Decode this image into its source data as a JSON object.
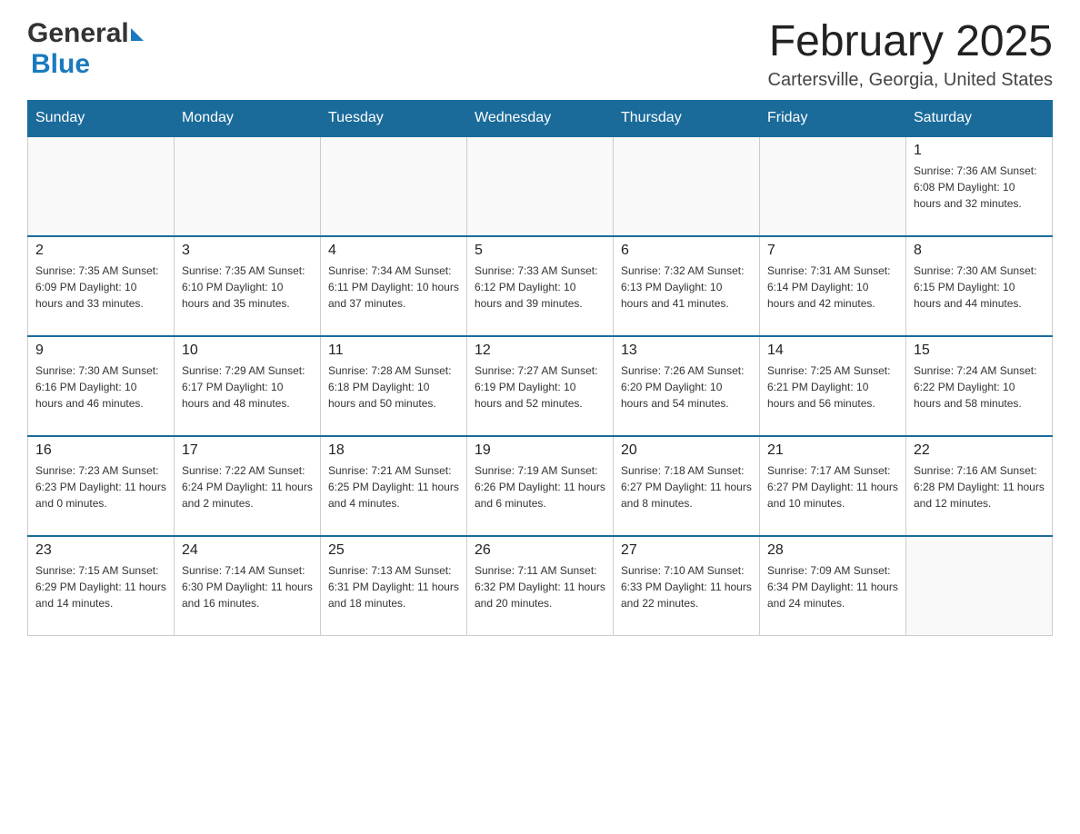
{
  "header": {
    "logo_general": "General",
    "logo_blue": "Blue",
    "month_title": "February 2025",
    "location": "Cartersville, Georgia, United States"
  },
  "calendar": {
    "days_of_week": [
      "Sunday",
      "Monday",
      "Tuesday",
      "Wednesday",
      "Thursday",
      "Friday",
      "Saturday"
    ],
    "weeks": [
      [
        {
          "day": "",
          "info": ""
        },
        {
          "day": "",
          "info": ""
        },
        {
          "day": "",
          "info": ""
        },
        {
          "day": "",
          "info": ""
        },
        {
          "day": "",
          "info": ""
        },
        {
          "day": "",
          "info": ""
        },
        {
          "day": "1",
          "info": "Sunrise: 7:36 AM\nSunset: 6:08 PM\nDaylight: 10 hours and 32 minutes."
        }
      ],
      [
        {
          "day": "2",
          "info": "Sunrise: 7:35 AM\nSunset: 6:09 PM\nDaylight: 10 hours and 33 minutes."
        },
        {
          "day": "3",
          "info": "Sunrise: 7:35 AM\nSunset: 6:10 PM\nDaylight: 10 hours and 35 minutes."
        },
        {
          "day": "4",
          "info": "Sunrise: 7:34 AM\nSunset: 6:11 PM\nDaylight: 10 hours and 37 minutes."
        },
        {
          "day": "5",
          "info": "Sunrise: 7:33 AM\nSunset: 6:12 PM\nDaylight: 10 hours and 39 minutes."
        },
        {
          "day": "6",
          "info": "Sunrise: 7:32 AM\nSunset: 6:13 PM\nDaylight: 10 hours and 41 minutes."
        },
        {
          "day": "7",
          "info": "Sunrise: 7:31 AM\nSunset: 6:14 PM\nDaylight: 10 hours and 42 minutes."
        },
        {
          "day": "8",
          "info": "Sunrise: 7:30 AM\nSunset: 6:15 PM\nDaylight: 10 hours and 44 minutes."
        }
      ],
      [
        {
          "day": "9",
          "info": "Sunrise: 7:30 AM\nSunset: 6:16 PM\nDaylight: 10 hours and 46 minutes."
        },
        {
          "day": "10",
          "info": "Sunrise: 7:29 AM\nSunset: 6:17 PM\nDaylight: 10 hours and 48 minutes."
        },
        {
          "day": "11",
          "info": "Sunrise: 7:28 AM\nSunset: 6:18 PM\nDaylight: 10 hours and 50 minutes."
        },
        {
          "day": "12",
          "info": "Sunrise: 7:27 AM\nSunset: 6:19 PM\nDaylight: 10 hours and 52 minutes."
        },
        {
          "day": "13",
          "info": "Sunrise: 7:26 AM\nSunset: 6:20 PM\nDaylight: 10 hours and 54 minutes."
        },
        {
          "day": "14",
          "info": "Sunrise: 7:25 AM\nSunset: 6:21 PM\nDaylight: 10 hours and 56 minutes."
        },
        {
          "day": "15",
          "info": "Sunrise: 7:24 AM\nSunset: 6:22 PM\nDaylight: 10 hours and 58 minutes."
        }
      ],
      [
        {
          "day": "16",
          "info": "Sunrise: 7:23 AM\nSunset: 6:23 PM\nDaylight: 11 hours and 0 minutes."
        },
        {
          "day": "17",
          "info": "Sunrise: 7:22 AM\nSunset: 6:24 PM\nDaylight: 11 hours and 2 minutes."
        },
        {
          "day": "18",
          "info": "Sunrise: 7:21 AM\nSunset: 6:25 PM\nDaylight: 11 hours and 4 minutes."
        },
        {
          "day": "19",
          "info": "Sunrise: 7:19 AM\nSunset: 6:26 PM\nDaylight: 11 hours and 6 minutes."
        },
        {
          "day": "20",
          "info": "Sunrise: 7:18 AM\nSunset: 6:27 PM\nDaylight: 11 hours and 8 minutes."
        },
        {
          "day": "21",
          "info": "Sunrise: 7:17 AM\nSunset: 6:27 PM\nDaylight: 11 hours and 10 minutes."
        },
        {
          "day": "22",
          "info": "Sunrise: 7:16 AM\nSunset: 6:28 PM\nDaylight: 11 hours and 12 minutes."
        }
      ],
      [
        {
          "day": "23",
          "info": "Sunrise: 7:15 AM\nSunset: 6:29 PM\nDaylight: 11 hours and 14 minutes."
        },
        {
          "day": "24",
          "info": "Sunrise: 7:14 AM\nSunset: 6:30 PM\nDaylight: 11 hours and 16 minutes."
        },
        {
          "day": "25",
          "info": "Sunrise: 7:13 AM\nSunset: 6:31 PM\nDaylight: 11 hours and 18 minutes."
        },
        {
          "day": "26",
          "info": "Sunrise: 7:11 AM\nSunset: 6:32 PM\nDaylight: 11 hours and 20 minutes."
        },
        {
          "day": "27",
          "info": "Sunrise: 7:10 AM\nSunset: 6:33 PM\nDaylight: 11 hours and 22 minutes."
        },
        {
          "day": "28",
          "info": "Sunrise: 7:09 AM\nSunset: 6:34 PM\nDaylight: 11 hours and 24 minutes."
        },
        {
          "day": "",
          "info": ""
        }
      ]
    ]
  }
}
